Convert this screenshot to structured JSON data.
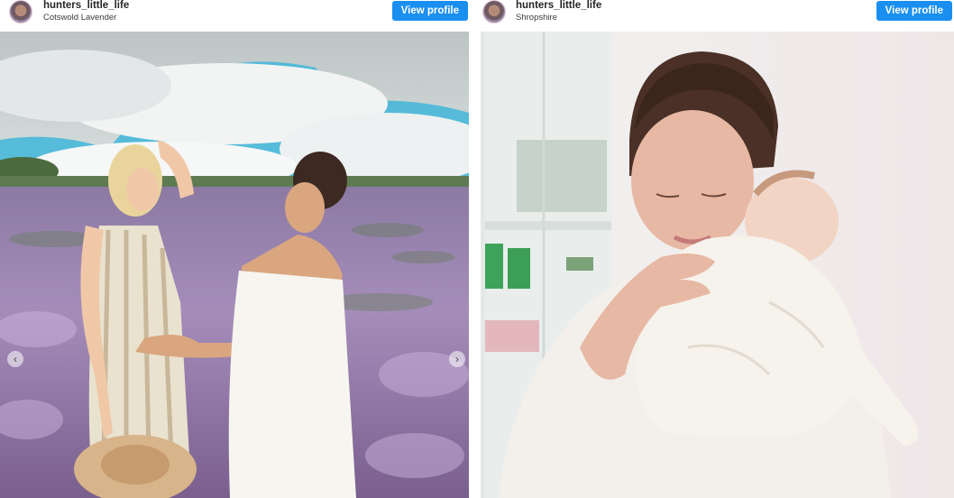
{
  "posts": [
    {
      "username": "hunters_little_life",
      "location": "Cotswold Lavender",
      "view_profile_label": "View profile",
      "image_subject": "two women in a lavender field",
      "carousel": {
        "prev_icon": "‹",
        "next_icon": "›"
      }
    },
    {
      "username": "hunters_little_life",
      "location": "Shropshire",
      "view_profile_label": "View profile",
      "image_subject": "woman holding a sleeping newborn"
    }
  ],
  "colors": {
    "button": "#1a8ff0",
    "lavender": "#a98bb8",
    "sky": "#3fb6d9"
  }
}
